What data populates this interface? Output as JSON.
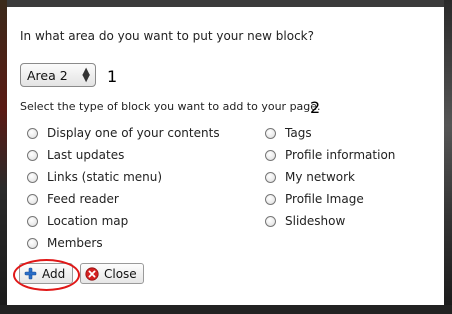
{
  "dialog": {
    "question": "In what area do you want to put your new block?",
    "area_selected": "Area 2",
    "step1": "1",
    "step2": "2",
    "subtitle": "Select the type of block you want to add to your page.",
    "options_left": [
      "Display one of your contents",
      "Last updates",
      "Links (static menu)",
      "Feed reader",
      "Location map",
      "Members"
    ],
    "options_right": [
      "Tags",
      "Profile information",
      "My network",
      "Profile Image",
      "Slideshow"
    ],
    "add_label": "Add",
    "close_label": "Close"
  },
  "colors": {
    "highlight": "#e01818",
    "add_icon": "#2a6fc9",
    "close_icon": "#d42020"
  }
}
